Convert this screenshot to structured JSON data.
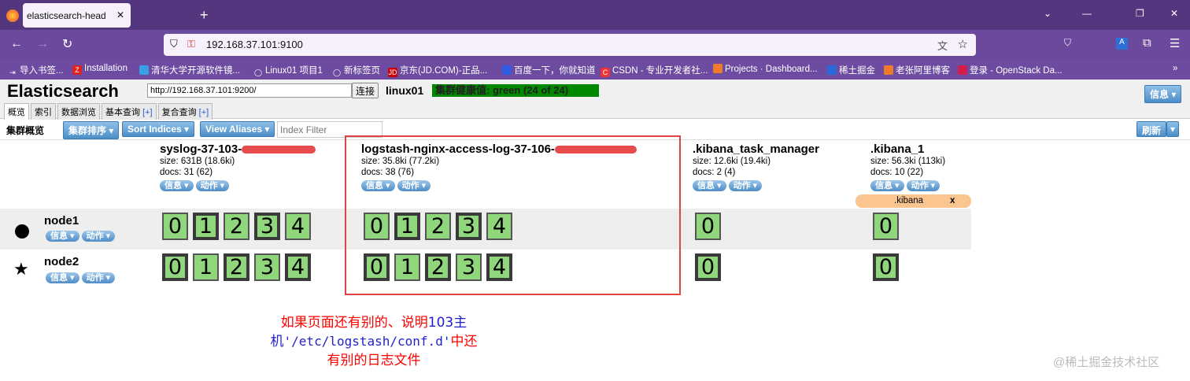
{
  "browser": {
    "tab_title": "elasticsearch-head",
    "url": "192.168.37.101:9100",
    "bookmarks": [
      "导入书签...",
      "Installation",
      "清华大学开源软件镜...",
      "Linux01 项目1",
      "新标签页",
      "京东(JD.COM)-正品...",
      "百度一下，你就知道",
      "CSDN - 专业开发者社...",
      "Projects · Dashboard...",
      "稀土掘金",
      "老张阿里博客",
      "登录 - OpenStack Da..."
    ]
  },
  "header": {
    "title": "Elasticsearch",
    "connect_url": "http://192.168.37.101:9200/",
    "connect_label": "连接",
    "cluster_name": "linux01",
    "health": "集群健康值: green (24 of 24)",
    "info_label": "信息"
  },
  "tabs": [
    {
      "label": "概览"
    },
    {
      "label": "索引"
    },
    {
      "label": "数据浏览"
    },
    {
      "label": "基本查询",
      "plus": "[+]"
    },
    {
      "label": "复合查询",
      "plus": "[+]"
    }
  ],
  "toolbar": {
    "title": "集群概览",
    "sort_cluster": "集群排序",
    "sort_indices": "Sort Indices",
    "view_aliases": "View Aliases",
    "filter_placeholder": "Index Filter",
    "refresh": "刷新"
  },
  "pill": {
    "info": "信息",
    "action": "动作"
  },
  "indices": [
    {
      "name": "syslog-37-103-",
      "size": "size: 631B (18.6ki)",
      "docs": "docs: 31 (62)"
    },
    {
      "name": "logstash-nginx-access-log-37-106-",
      "size": "size: 35.8ki (77.2ki)",
      "docs": "docs: 38 (76)"
    },
    {
      "name": ".kibana_task_manager",
      "size": "size: 12.6ki (19.4ki)",
      "docs": "docs: 2 (4)"
    },
    {
      "name": ".kibana_1",
      "size": "size: 56.3ki (113ki)",
      "docs": "docs: 10 (22)",
      "alias": ".kibana",
      "alias_close": "x"
    }
  ],
  "nodes": [
    {
      "name": "node1",
      "icon": "circle"
    },
    {
      "name": "node2",
      "icon": "star"
    }
  ],
  "shards": [
    "0",
    "1",
    "2",
    "3",
    "4"
  ],
  "annotation": {
    "line1a": "如果页面还有别的、说明",
    "line1b": "103主",
    "line2a": "机",
    "line2b": "'/etc/logstash/conf.d'",
    "line2c": "中还",
    "line3": "有别的日志文件"
  },
  "watermark": "@稀土掘金技术社区"
}
